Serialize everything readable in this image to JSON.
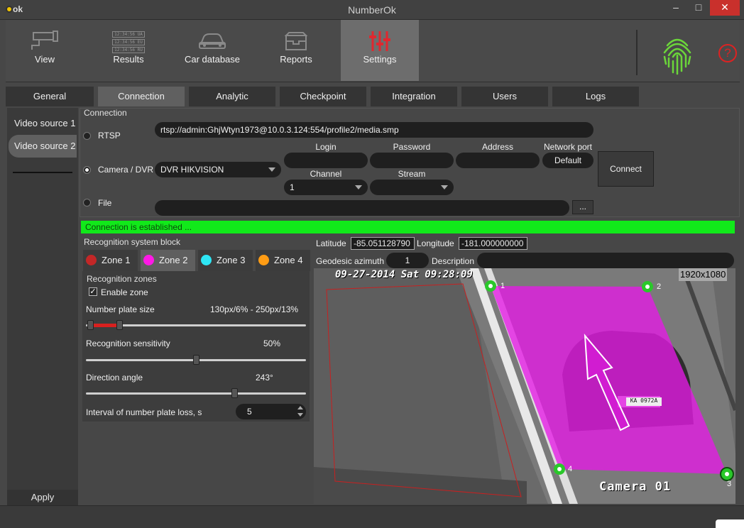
{
  "window": {
    "title": "NumberOk",
    "logo_text": "ok",
    "minimize": "–",
    "maximize": "□",
    "close": "✕"
  },
  "toolbar": {
    "items": [
      {
        "label": "View",
        "icon": "camera-icon"
      },
      {
        "label": "Results",
        "icon": "results-icon"
      },
      {
        "label": "Car database",
        "icon": "car-icon"
      },
      {
        "label": "Reports",
        "icon": "reports-icon"
      },
      {
        "label": "Settings",
        "icon": "settings-icon"
      }
    ],
    "results_icon_lines": [
      "12:34:56 UA",
      "12:34:56 EU",
      "12:34:56 RU"
    ],
    "help": "?"
  },
  "tabs": [
    "General",
    "Connection",
    "Analytic",
    "Checkpoint",
    "Integration",
    "Users",
    "Logs"
  ],
  "active_tab": "Connection",
  "sidebar": {
    "sources": [
      "Video source 1",
      "Video source 2"
    ],
    "active": "Video source 2",
    "apply_label": "Apply"
  },
  "connection": {
    "section_title": "Connection",
    "rtsp_label": "RTSP",
    "rtsp_url": "rtsp://admin:GhjWtyn1973@10.0.3.124:554/profile2/media.smp",
    "camera_label": "Camera / DVR",
    "camera_value": "DVR HIKVISION",
    "login_label": "Login",
    "password_label": "Password",
    "address_label": "Address",
    "port_label": "Network port",
    "port_value": "Default",
    "channel_label": "Channel",
    "channel_value": "1",
    "stream_label": "Stream",
    "connect_label": "Connect",
    "file_label": "File",
    "browse_label": "...",
    "status": "Connection is established ..."
  },
  "recognition": {
    "block_title": "Recognition system block",
    "zones": [
      {
        "label": "Zone 1",
        "color": "#c32727"
      },
      {
        "label": "Zone 2",
        "color": "#ff19e6"
      },
      {
        "label": "Zone 3",
        "color": "#2ee6f5"
      },
      {
        "label": "Zone 4",
        "color": "#ff9c14"
      }
    ],
    "active_zone": "Zone 2",
    "zones_title": "Recognition zones",
    "enable_zone_label": "Enable zone",
    "plate_size_label": "Number plate size",
    "plate_size_value": "130px/6% - 250px/13%",
    "plate_size_range": [
      0.0,
      0.15
    ],
    "sensitivity_label": "Recognition sensitivity",
    "sensitivity_value": "50%",
    "sensitivity_fraction": 0.5,
    "direction_label": "Direction angle",
    "direction_value": "243°",
    "direction_fraction": 0.675,
    "interval_label": "Interval of number plate loss, s",
    "interval_value": "5"
  },
  "geo": {
    "latitude_label": "Latitude",
    "latitude_value": "-85.051128790",
    "longitude_label": "Longitude",
    "longitude_value": "-181.000000000",
    "azimuth_label": "Geodesic azimuth",
    "azimuth_value": "1",
    "description_label": "Description"
  },
  "video": {
    "resolution": "1920x1080",
    "timestamp": "09-27-2014 Sat 09:28:09",
    "camera_name": "Camera 01",
    "plate_text": "KA 0972A",
    "points": [
      "1",
      "2",
      "3",
      "4"
    ],
    "zone_color": "#e619e6"
  }
}
